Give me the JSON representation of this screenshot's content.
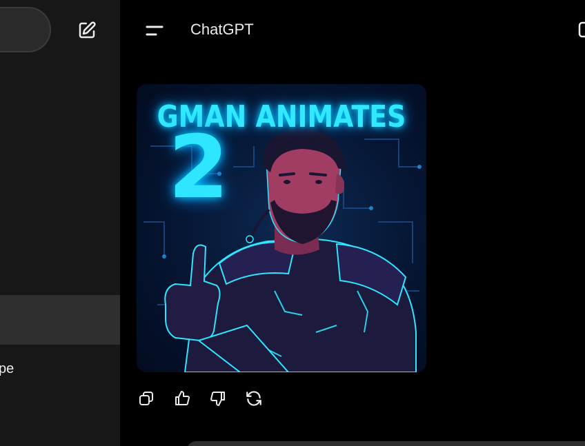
{
  "header": {
    "title": "ChatGPT"
  },
  "sidebar": {
    "new_chat_icon": "edit-icon",
    "truncated_chat_item": "pe"
  },
  "image": {
    "title": "GMAN ANIMATES",
    "number": "2",
    "colors": {
      "neon": "#2ee6ff",
      "background": "#061634",
      "skin": "#a13d63",
      "armor": "#1c1a3d"
    }
  },
  "actions": [
    {
      "icon": "copy-icon"
    },
    {
      "icon": "thumbs-up-icon"
    },
    {
      "icon": "thumbs-down-icon"
    },
    {
      "icon": "regenerate-icon"
    }
  ]
}
